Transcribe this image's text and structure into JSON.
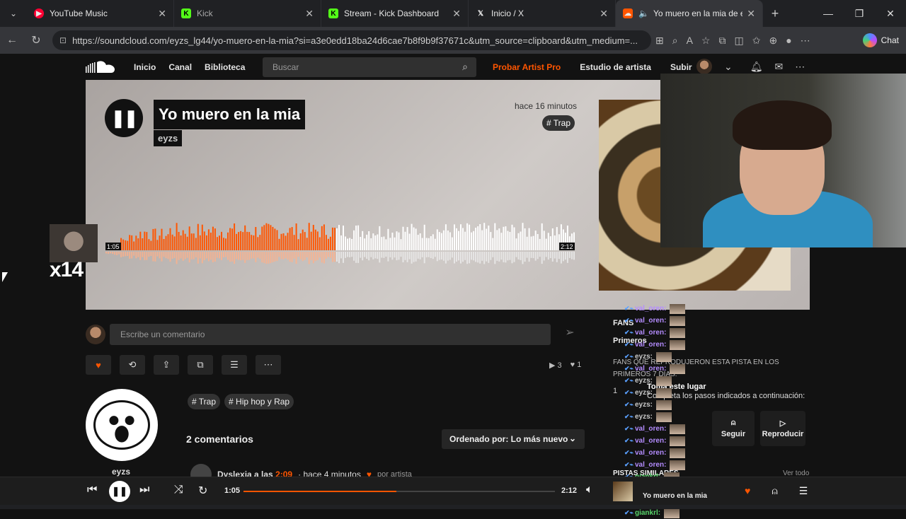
{
  "tabs": [
    {
      "label": "YouTube Music",
      "color": "#ff0033"
    },
    {
      "label": "Kick",
      "color": "#53fc18"
    },
    {
      "label": "Stream - Kick Dashboard",
      "color": "#53fc18"
    },
    {
      "label": "Inicio / X",
      "color": "#ffffff"
    },
    {
      "label": "Yo muero en la mia de eyzs",
      "color": "#ff5500"
    }
  ],
  "browser": {
    "url": "https://soundcloud.com/eyzs_lg44/yo-muero-en-la-mia?si=a3e0edd18ba24d6cae7b8f9b9f37671c&utm_source=clipboard&utm_medium=...",
    "chat_label": "Chat"
  },
  "header": {
    "nav": [
      "Inicio",
      "Canal",
      "Biblioteca"
    ],
    "search_placeholder": "Buscar",
    "pro": "Probar Artist Pro",
    "studio": "Estudio de artista",
    "upload": "Subir"
  },
  "track": {
    "title": "Yo muero en la mia",
    "artist": "eyzs",
    "posted": "hace 16 minutos",
    "genre": "# Trap",
    "current_time": "1:05",
    "duration": "2:12",
    "progress": 0.49
  },
  "overlay": {
    "multiplier": "x14"
  },
  "comment": {
    "placeholder": "Escribe un comentario"
  },
  "stats": {
    "plays": "3",
    "likes": "1"
  },
  "artist_block": {
    "name": "eyzs",
    "tags": [
      "# Trap",
      "# Hip hop y Rap"
    ],
    "comments_count": "2 comentarios",
    "sort_label": "Ordenado por: Lo más nuevo"
  },
  "first_comment": {
    "author": "Dyslexia a las",
    "time": "2:09",
    "ago": "· hace 4 minutos",
    "by": "por artista"
  },
  "sidebar": {
    "fans": "FANS",
    "primeros": "Primeros",
    "fans_desc": "FANS QUE REPRODUJERON ESTA PISTA EN LOS PRIMEROS 7 DÍAS:",
    "rank": "1",
    "toma": "Toma este lugar",
    "completa": "Completa los pasos indicados a continuación:",
    "seguir": "Seguir",
    "reproducir": "Reproducir",
    "similares": "PISTAS SIMILARES",
    "ver_todo": "Ver todo"
  },
  "chat": [
    {
      "user": "val_oren:",
      "cls": "u1"
    },
    {
      "user": "val_oren:",
      "cls": "u1"
    },
    {
      "user": "val_oren:",
      "cls": "u1"
    },
    {
      "user": "val_oren:",
      "cls": "u1"
    },
    {
      "user": "eyzs:",
      "cls": "u2"
    },
    {
      "user": "val_oren:",
      "cls": "u1"
    },
    {
      "user": "eyzs:",
      "cls": "u2"
    },
    {
      "user": "eyzs:",
      "cls": "u2"
    },
    {
      "user": "eyzs:",
      "cls": "u2"
    },
    {
      "user": "eyzs:",
      "cls": "u2"
    },
    {
      "user": "val_oren:",
      "cls": "u1"
    },
    {
      "user": "val_oren:",
      "cls": "u1"
    },
    {
      "user": "val_oren:",
      "cls": "u1"
    },
    {
      "user": "val_oren:",
      "cls": "u1"
    },
    {
      "user": "giankrl:",
      "cls": "u3"
    },
    {
      "user": "giankrl:",
      "cls": "u3"
    },
    {
      "user": "giankrl:",
      "cls": "u3"
    },
    {
      "user": "giankrl:",
      "cls": "u3"
    }
  ],
  "player": {
    "now_playing": "Yo muero en la mia",
    "current_time": "1:05",
    "duration": "2:12"
  },
  "colors": {
    "accent": "#ff5500",
    "background": "#121212"
  }
}
